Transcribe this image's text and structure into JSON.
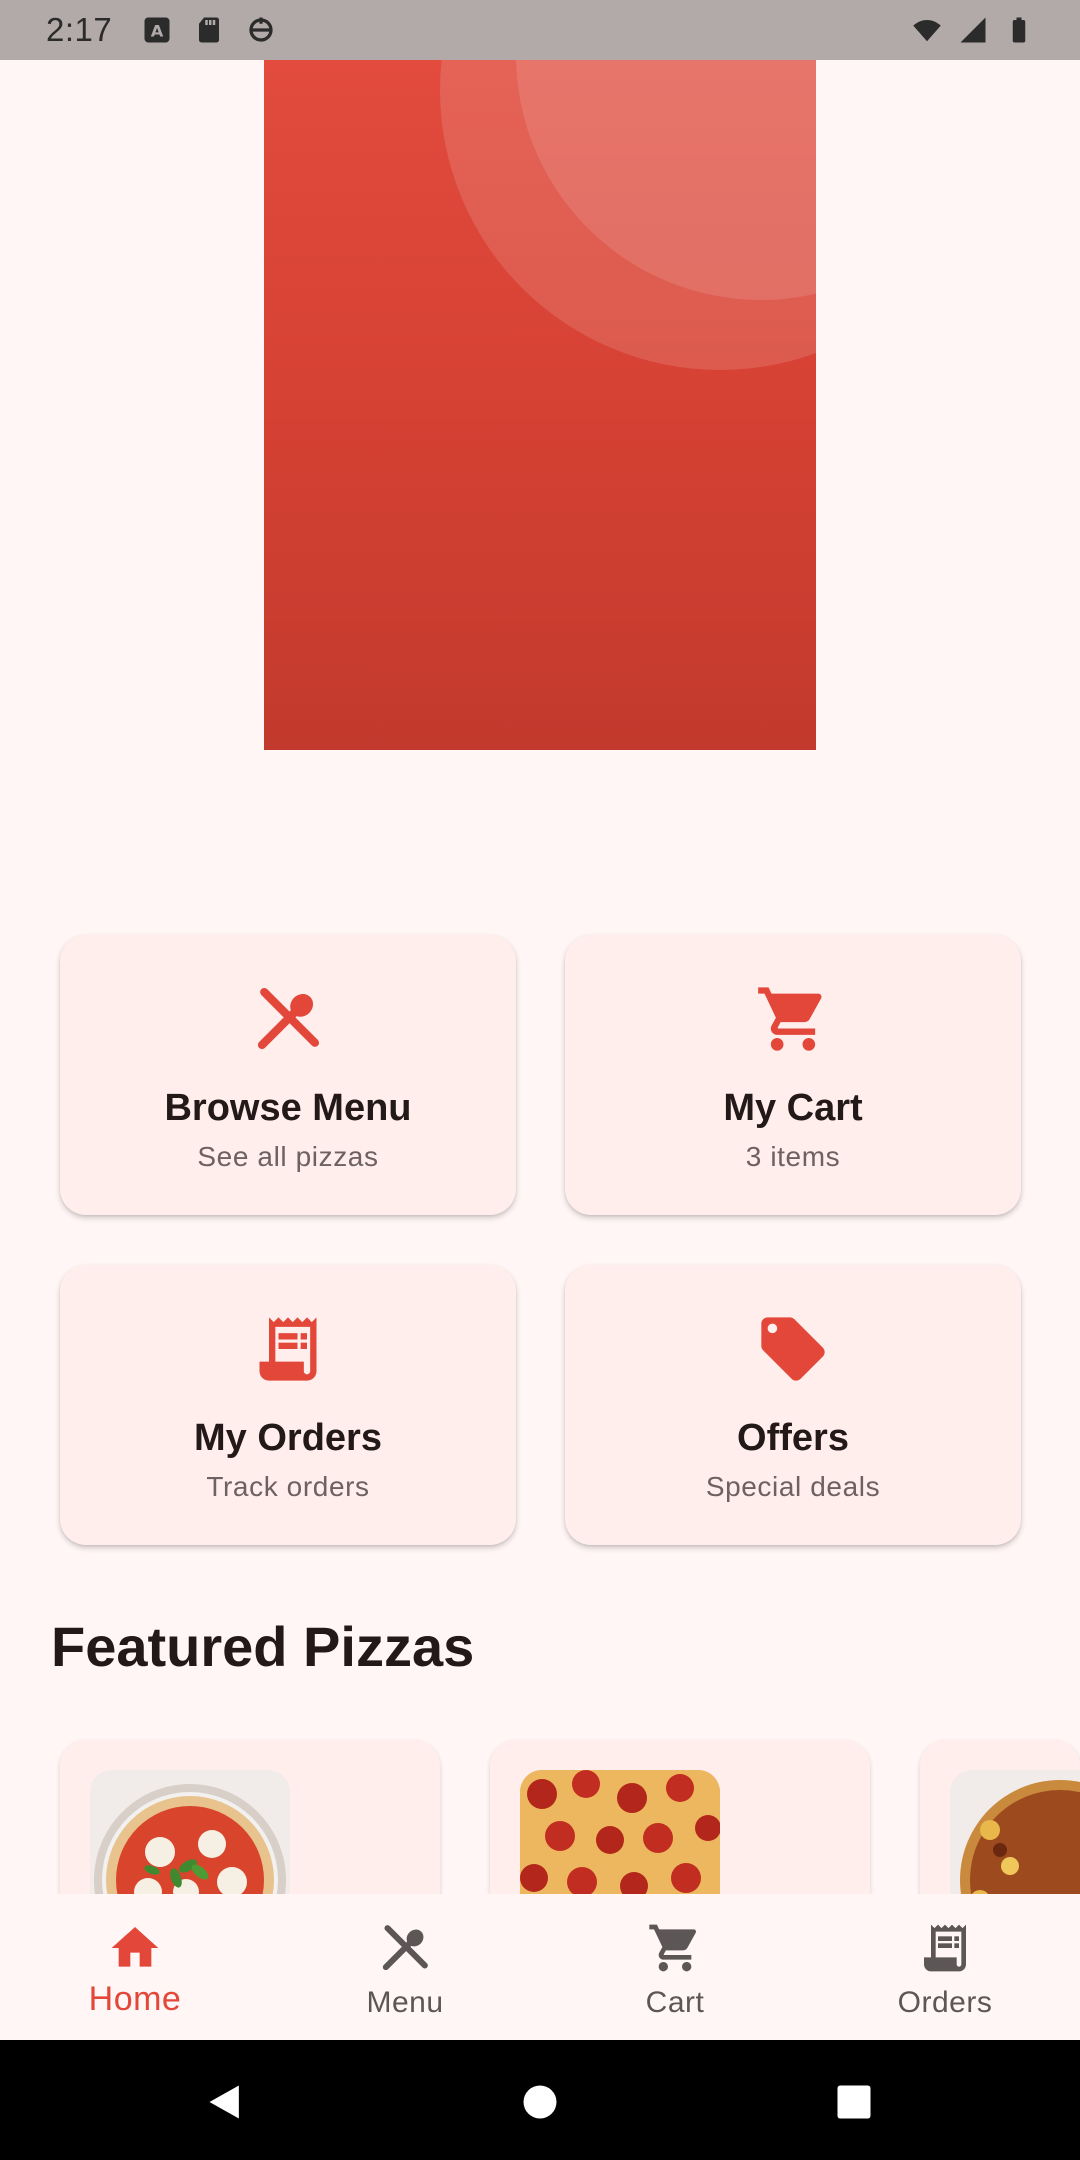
{
  "status_bar": {
    "time": "2:17"
  },
  "quick_actions": [
    {
      "title": "Browse Menu",
      "subtitle": "See all pizzas",
      "icon": "utensils-icon"
    },
    {
      "title": "My Cart",
      "subtitle": "3 items",
      "icon": "cart-icon"
    },
    {
      "title": "My Orders",
      "subtitle": "Track orders",
      "icon": "receipt-icon"
    },
    {
      "title": "Offers",
      "subtitle": "Special deals",
      "icon": "tag-icon"
    }
  ],
  "featured": {
    "title": "Featured Pizzas",
    "items": [
      {
        "image": "margherita-pizza-image"
      },
      {
        "image": "pepperoni-pizza-image"
      },
      {
        "image": "bbq-pizza-image"
      }
    ]
  },
  "bottom_nav": {
    "items": [
      {
        "label": "Home",
        "icon": "home-icon",
        "active": true
      },
      {
        "label": "Menu",
        "icon": "utensils-icon",
        "active": false
      },
      {
        "label": "Cart",
        "icon": "cart-icon",
        "active": false
      },
      {
        "label": "Orders",
        "icon": "receipt-icon",
        "active": false
      }
    ]
  },
  "colors": {
    "accent": "#e2473a",
    "background": "#fff6f5",
    "card": "#ffeeec",
    "text": "#231919"
  }
}
